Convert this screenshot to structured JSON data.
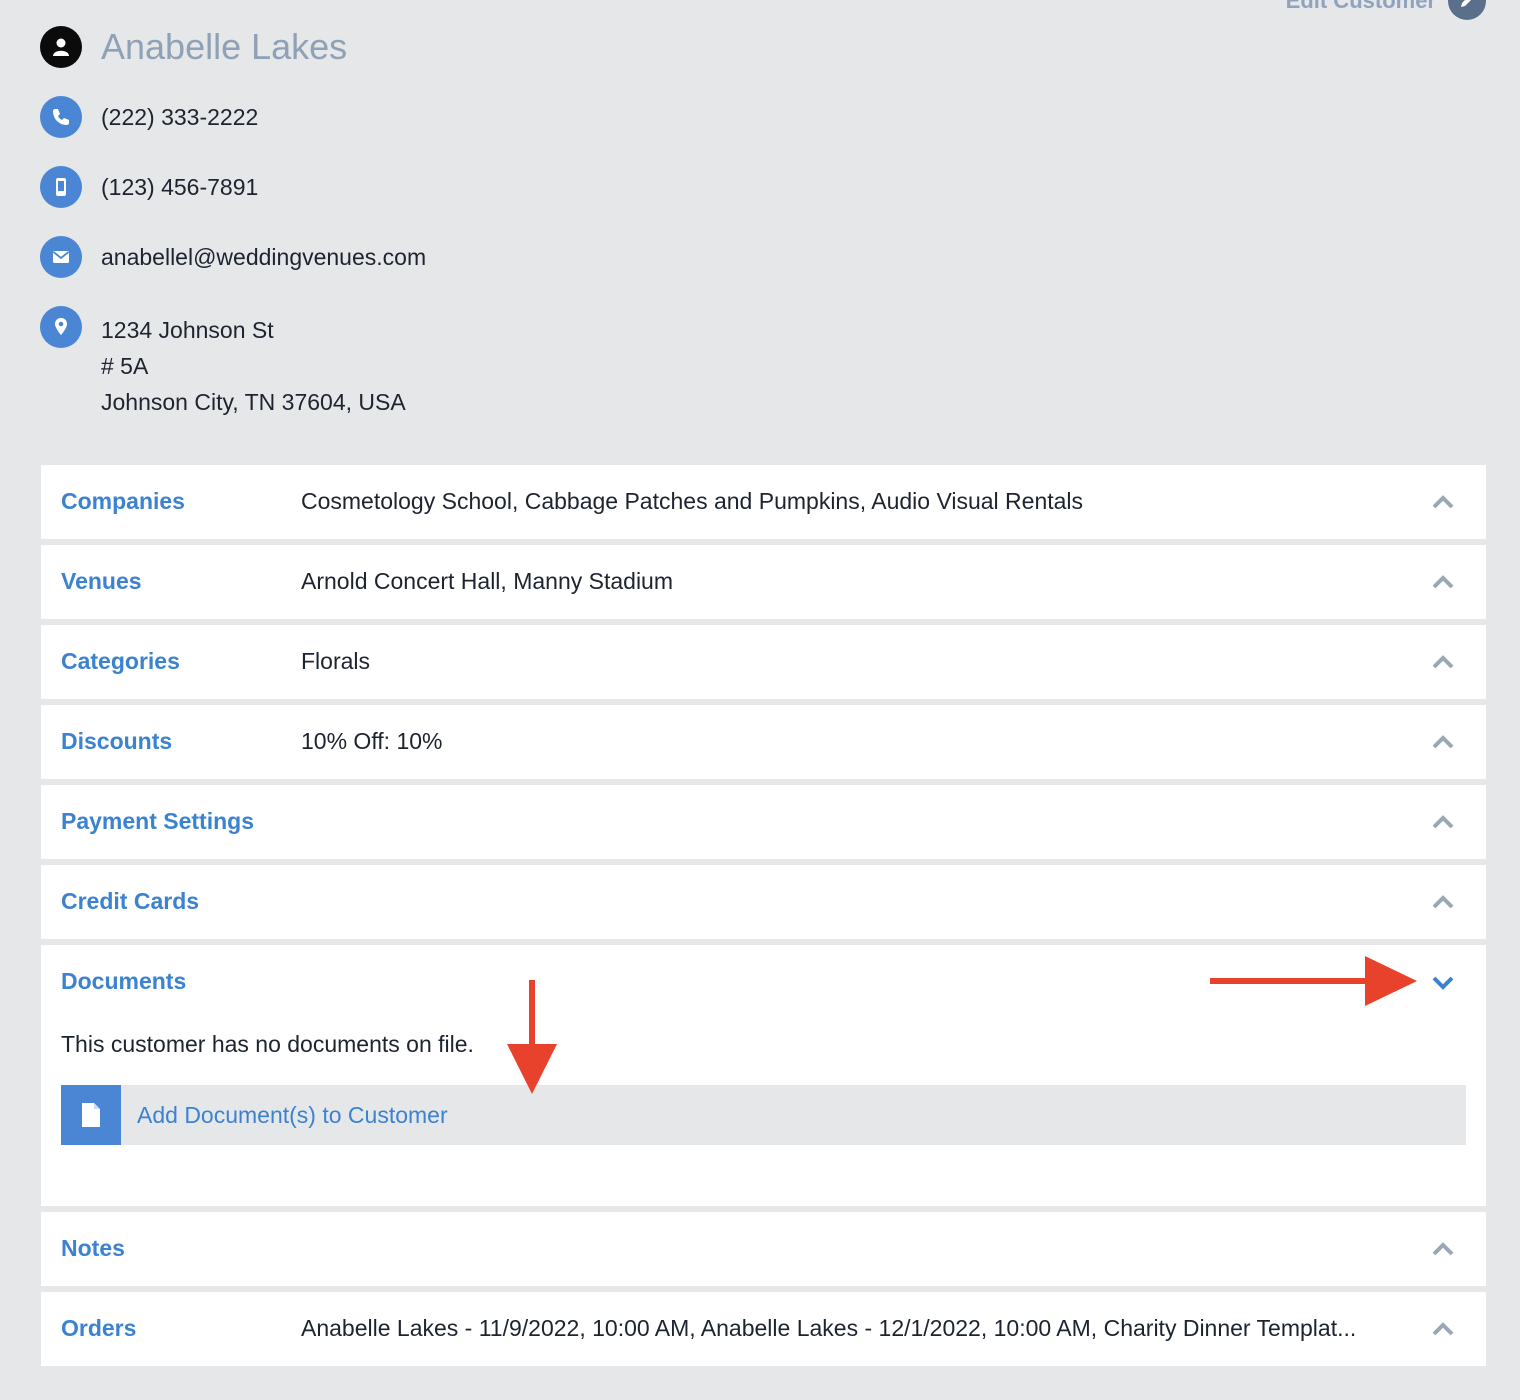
{
  "header": {
    "edit_label": "Edit Customer"
  },
  "customer": {
    "name": "Anabelle Lakes",
    "phone": "(222) 333-2222",
    "mobile": "(123) 456-7891",
    "email": "anabellel@weddingvenues.com",
    "address_line1": "1234 Johnson St",
    "address_line2": "# 5A",
    "address_line3": "Johnson City, TN 37604, USA"
  },
  "icons": {
    "name": "person-icon",
    "phone": "phone-icon",
    "mobile": "mobile-phone-icon",
    "email": "envelope-icon",
    "address": "map-pin-icon",
    "edit": "pencil-icon",
    "document": "document-icon"
  },
  "sections": {
    "companies": {
      "title": "Companies",
      "value": "Cosmetology School, Cabbage Patches and Pumpkins, Audio Visual Rentals"
    },
    "venues": {
      "title": "Venues",
      "value": "Arnold Concert Hall, Manny Stadium"
    },
    "categories": {
      "title": "Categories",
      "value": "Florals"
    },
    "discounts": {
      "title": "Discounts",
      "value": "10% Off: 10%"
    },
    "payment_settings": {
      "title": "Payment Settings"
    },
    "credit_cards": {
      "title": "Credit Cards"
    },
    "documents": {
      "title": "Documents",
      "empty_message": "This customer has no documents on file.",
      "add_label": "Add Document(s) to Customer"
    },
    "notes": {
      "title": "Notes"
    },
    "orders": {
      "title": "Orders",
      "value": "Anabelle Lakes - 11/9/2022, 10:00 AM, Anabelle Lakes - 12/1/2022, 10:00 AM, Charity Dinner Templat..."
    }
  },
  "colors": {
    "accent": "#3b82d1",
    "icon_bg": "#4a86d4",
    "annotation_arrow": "#e8412c",
    "page_bg": "#e6e7e9"
  }
}
